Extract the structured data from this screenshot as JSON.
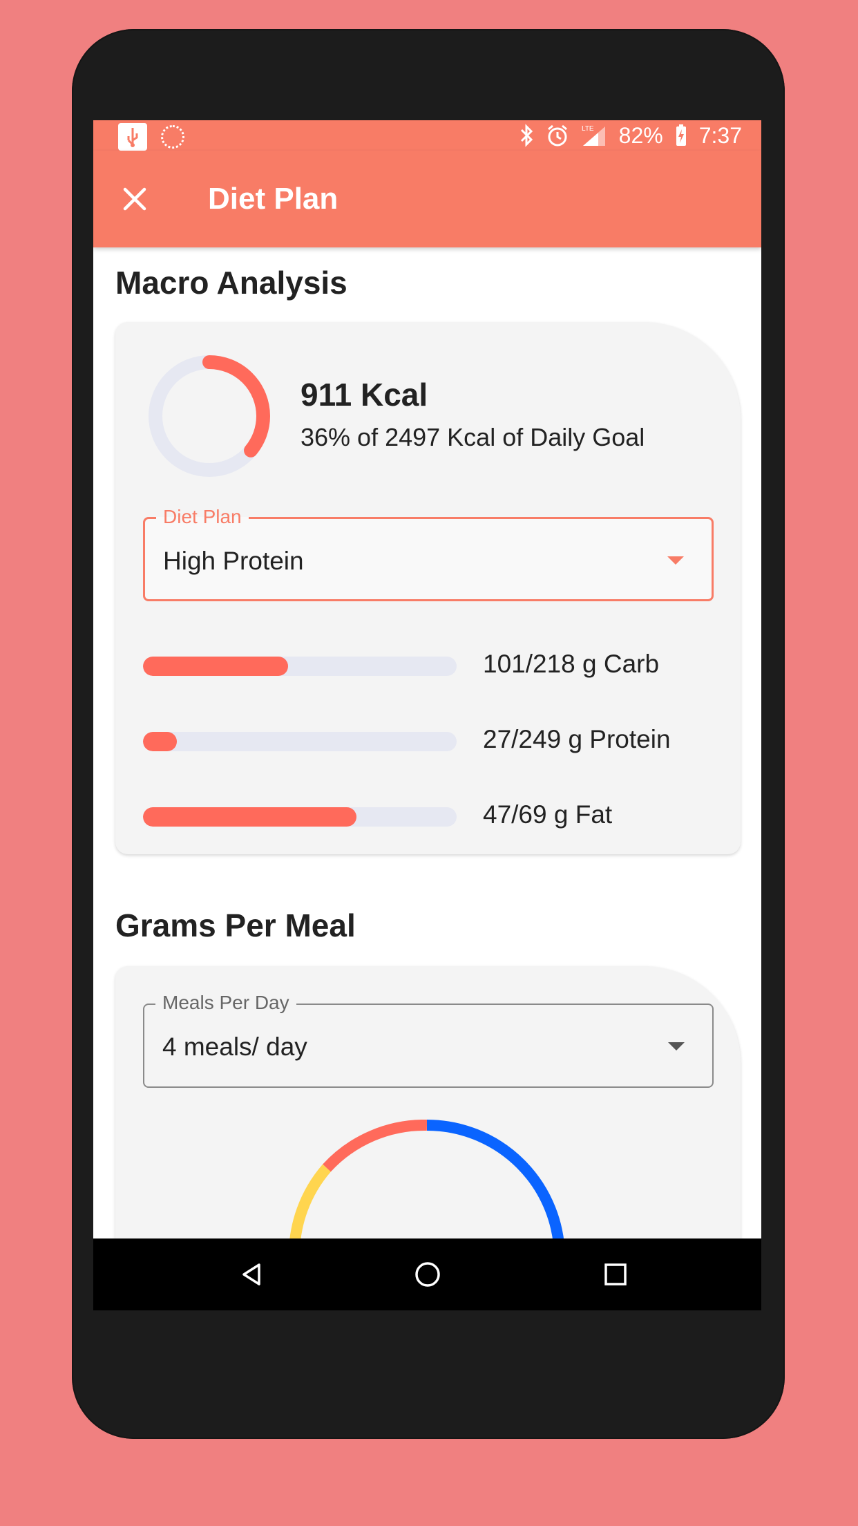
{
  "status_bar": {
    "battery": "82%",
    "time": "7:37",
    "network": "LTE",
    "icons": [
      "usb-icon",
      "loading-icon",
      "bluetooth-icon",
      "alarm-icon",
      "signal-icon",
      "battery-charging-icon"
    ]
  },
  "app_bar": {
    "title": "Diet Plan",
    "close_icon": "close-icon"
  },
  "macro_analysis": {
    "title": "Macro Analysis",
    "kcal_value": "911 Kcal",
    "kcal_subtitle": "36% of 2497 Kcal of Daily Goal",
    "kcal_progress": 0.36,
    "diet_plan_field": {
      "label": "Diet Plan",
      "value": "High Protein"
    },
    "macros": [
      {
        "label": "101/218 g Carb",
        "progress": 0.463
      },
      {
        "label": "27/249 g Protein",
        "progress": 0.108
      },
      {
        "label": "47/69 g Fat",
        "progress": 0.681
      }
    ]
  },
  "grams_per_meal": {
    "title": "Grams Per Meal",
    "meals_field": {
      "label": "Meals Per Day",
      "value": "4 meals/ day"
    },
    "ring_segments": [
      {
        "color": "#FFD54F"
      },
      {
        "color": "#FF6A5B"
      },
      {
        "color": "#0A64FF"
      }
    ]
  },
  "colors": {
    "accent": "#F87C66",
    "bar_fill": "#FF6A5B",
    "track": "#E6E8F2",
    "background": "#F08080"
  },
  "nav_bar": {
    "icons": [
      "back-icon",
      "home-icon",
      "recents-icon"
    ]
  }
}
